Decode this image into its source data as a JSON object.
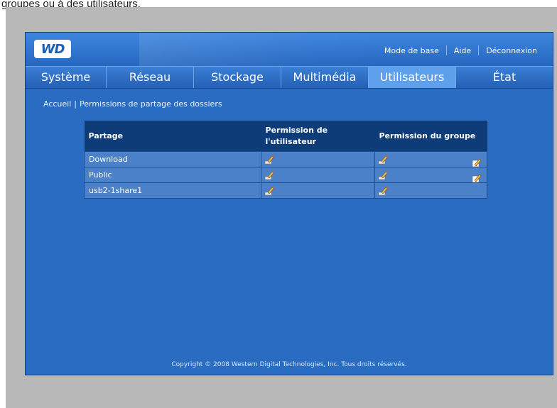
{
  "caption": "groupes ou à des utilisateurs.",
  "header": {
    "logo_text": "WD",
    "links": [
      "Mode de base",
      "Aide",
      "Déconnexion"
    ]
  },
  "nav": {
    "tabs": [
      {
        "label": "Système",
        "active": false
      },
      {
        "label": "Réseau",
        "active": false
      },
      {
        "label": "Stockage",
        "active": false
      },
      {
        "label": "Multimédia",
        "active": false
      },
      {
        "label": "Utilisateurs",
        "active": true
      },
      {
        "label": "État",
        "active": false
      }
    ]
  },
  "breadcrumb": {
    "home": "Accueil",
    "separator": "|",
    "current": "Permissions de partage des dossiers"
  },
  "table": {
    "headers": {
      "share": "Partage",
      "user_perm": "Permission de l'utilisateur",
      "group_perm": "Permission du groupe"
    },
    "rows": [
      {
        "share": "Download",
        "user_icon": "user-permission-icon",
        "group_icon": "group-permission-icon",
        "edit": true
      },
      {
        "share": "Public",
        "user_icon": "user-permission-icon",
        "group_icon": "group-permission-icon",
        "edit": true
      },
      {
        "share": "usb2-1share1",
        "user_icon": "user-permission-icon",
        "group_icon": "group-permission-icon",
        "edit": false
      }
    ]
  },
  "footer": {
    "copyright": "Copyright © 2008 Western Digital Technologies, Inc. Tous droits réservés."
  },
  "colors": {
    "panel": "#2a6cc2",
    "active_tab": "#5fa0ec",
    "table_header": "#0d3c78",
    "table_row": "#4b81c9"
  }
}
